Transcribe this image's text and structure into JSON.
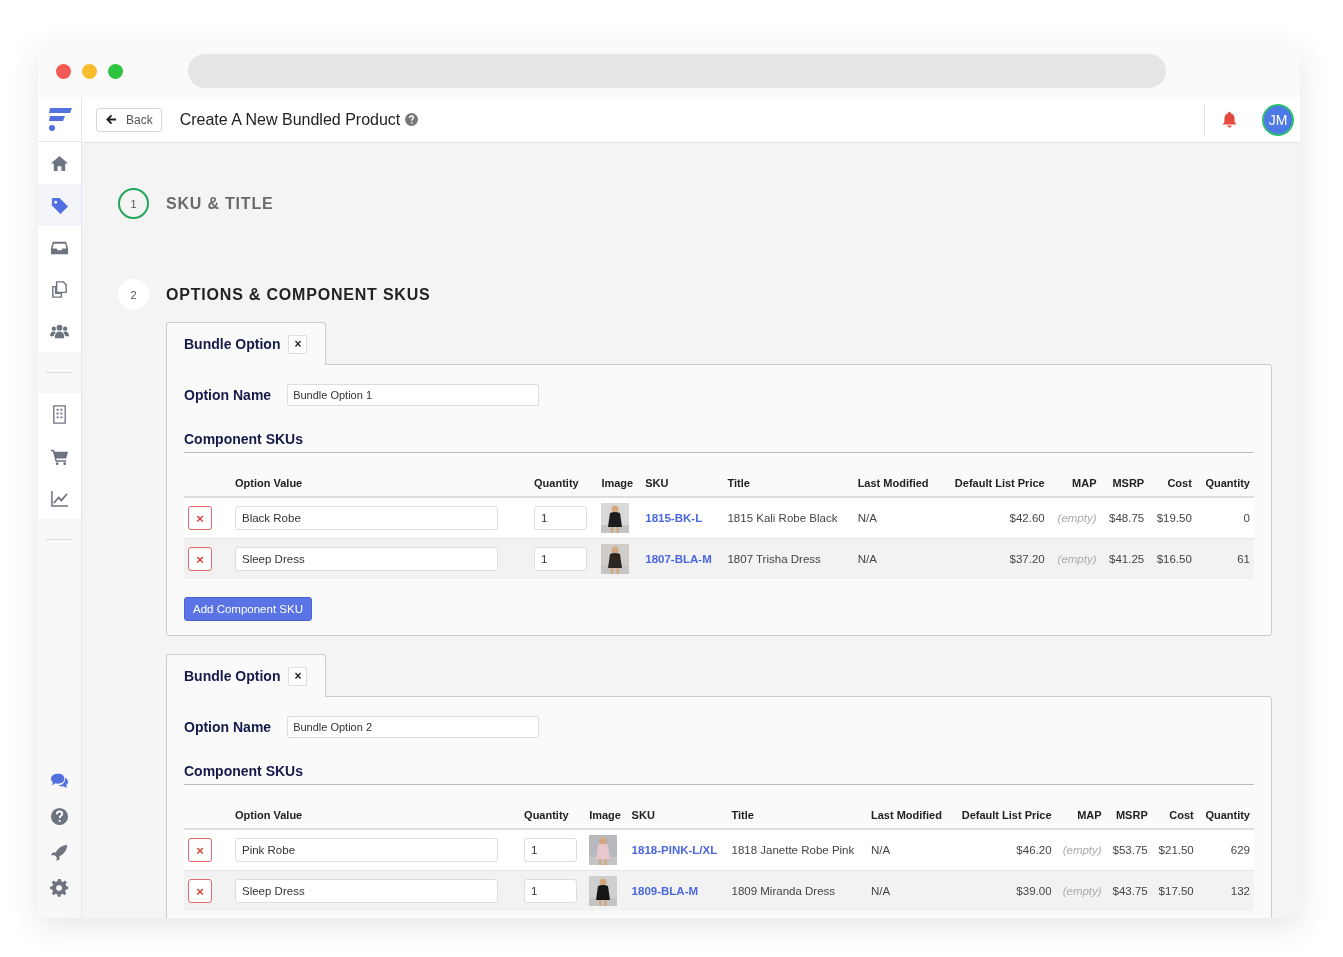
{
  "header": {
    "back_label": "Back",
    "title": "Create A New Bundled Product",
    "avatar_initials": "JM"
  },
  "sidebar": {
    "top_items": [
      {
        "selected": false
      },
      {
        "selected": true
      },
      {
        "selected": false
      },
      {
        "selected": false
      },
      {
        "selected": false
      }
    ],
    "middle_items": [
      {
        "selected": false
      },
      {
        "selected": false
      },
      {
        "selected": false
      }
    ],
    "bottom_items": [
      {
        "selected": true
      },
      {
        "selected": false
      },
      {
        "selected": false
      },
      {
        "selected": false
      }
    ]
  },
  "steps": [
    {
      "number": "1",
      "title": "SKU & TITLE",
      "done": true
    },
    {
      "number": "2",
      "title": "OPTIONS & COMPONENT SKUS",
      "done": false
    }
  ],
  "bundle_options": [
    {
      "columns": [
        "Option Value",
        "Quantity",
        "Image",
        "SKU",
        "Title",
        "Last Modified",
        "Default List Price",
        "MAP",
        "MSRP",
        "Cost",
        "Quantity"
      ],
      "tab_label": "Bundle Option",
      "close": "×",
      "option_name_label": "Option Name",
      "option_name": "Bundle Option 1",
      "components_heading": "Component SKUs",
      "add_button": "Add Component SKU",
      "rows": [
        {
          "remove": "×",
          "option_value": "Black Robe",
          "quantity": "1",
          "sku": "1815-BK-L",
          "title": "1815 Kali Robe Black",
          "last_modified": "N/A",
          "default_list_price": "$42.60",
          "map": "(empty)",
          "msrp": "$48.75",
          "cost": "$19.50",
          "stock": "0"
        },
        {
          "remove": "×",
          "option_value": "Sleep Dress",
          "quantity": "1",
          "sku": "1807-BLA-M",
          "title": "1807 Trisha Dress",
          "last_modified": "N/A",
          "default_list_price": "$37.20",
          "map": "(empty)",
          "msrp": "$41.25",
          "cost": "$16.50",
          "stock": "61"
        }
      ]
    },
    {
      "columns": [
        "Option Value",
        "Quantity",
        "Image",
        "SKU",
        "Title",
        "Last Modified",
        "Default List Price",
        "MAP",
        "MSRP",
        "Cost",
        "Quantity"
      ],
      "tab_label": "Bundle Option",
      "close": "×",
      "option_name_label": "Option Name",
      "option_name": "Bundle Option 2",
      "components_heading": "Component SKUs",
      "rows": [
        {
          "remove": "×",
          "option_value": "Pink Robe",
          "quantity": "1",
          "sku": "1818-PINK-L/XL",
          "title": "1818 Janette Robe Pink",
          "last_modified": "N/A",
          "default_list_price": "$46.20",
          "map": "(empty)",
          "msrp": "$53.75",
          "cost": "$21.50",
          "stock": "629"
        },
        {
          "remove": "×",
          "option_value": "Sleep Dress",
          "quantity": "1",
          "sku": "1809-BLA-M",
          "title": "1809 Miranda Dress",
          "last_modified": "N/A",
          "default_list_price": "$39.00",
          "map": "(empty)",
          "msrp": "$43.75",
          "cost": "$17.50",
          "stock": "132"
        }
      ]
    }
  ]
}
